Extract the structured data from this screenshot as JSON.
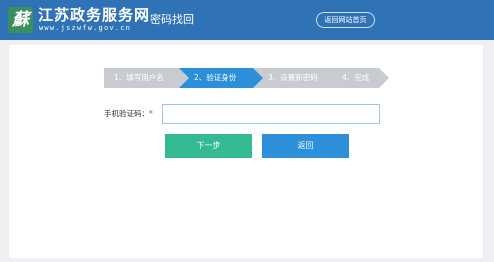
{
  "header": {
    "logo_glyph": "蘇",
    "site_name": "江苏政务服务网",
    "site_url": "www.jszwfw.gov.cn",
    "page_title": "密码找回",
    "home_button_label": "返回网站首页",
    "background_color": "#2f72b5"
  },
  "steps": [
    {
      "label": "1、填写用户名",
      "state": "done"
    },
    {
      "label": "2、验证身份",
      "state": "active"
    },
    {
      "label": "3、设置新密码",
      "state": "pending"
    },
    {
      "label": "4、完成",
      "state": "pending"
    }
  ],
  "form": {
    "sms_label": "手机验证码：",
    "required_marker": "*",
    "sms_value": "",
    "sms_placeholder": ""
  },
  "buttons": {
    "next_label": "下一步",
    "back_label": "返回"
  },
  "colors": {
    "active_step": "#2b8fd9",
    "inactive_step": "#c8cbd0",
    "next_button": "#34ba92",
    "back_button": "#2b8fd9"
  }
}
